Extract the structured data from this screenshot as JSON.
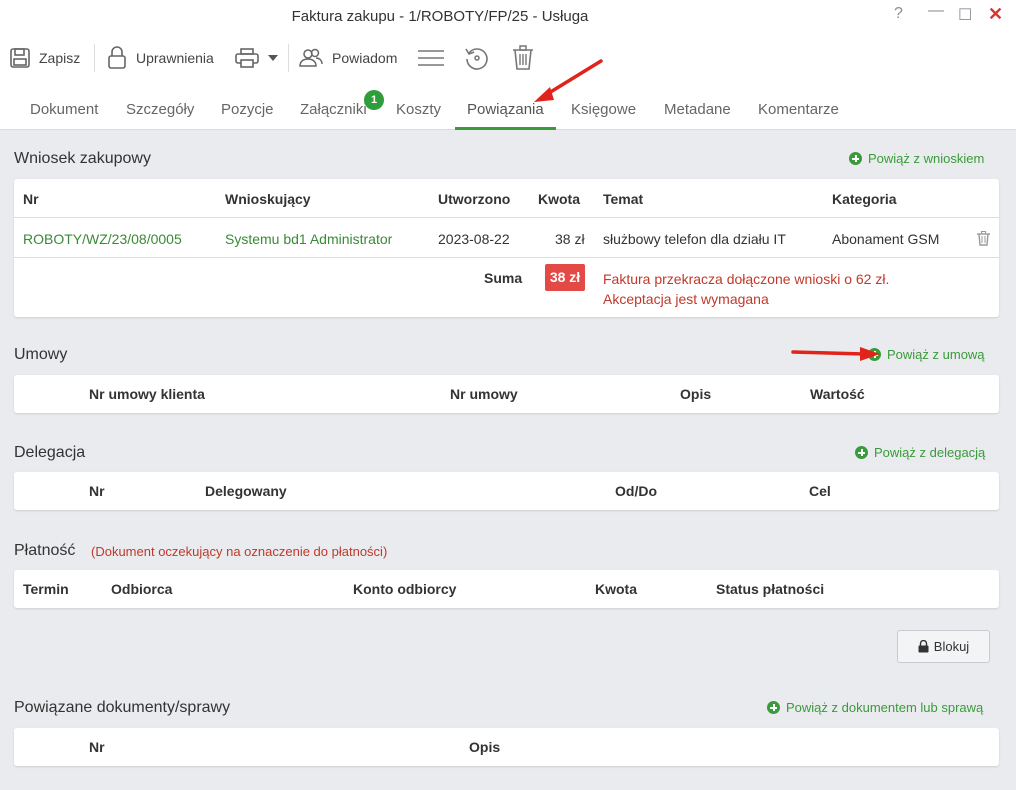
{
  "window": {
    "title": "Faktura zakupu - 1/ROBOTY/FP/25 - Usługa",
    "help": "?",
    "minimize": "—",
    "maximize": "☐",
    "close": "✕"
  },
  "toolbar": {
    "save_label": "Zapisz",
    "permissions_label": "Uprawnienia",
    "notify_label": "Powiadom"
  },
  "tabs": [
    {
      "label": "Dokument"
    },
    {
      "label": "Szczegóły"
    },
    {
      "label": "Pozycje"
    },
    {
      "label": "Załączniki",
      "badge": "1"
    },
    {
      "label": "Koszty"
    },
    {
      "label": "Powiązania",
      "active": true
    },
    {
      "label": "Księgowe"
    },
    {
      "label": "Metadane"
    },
    {
      "label": "Komentarze"
    }
  ],
  "purchase_request": {
    "title": "Wniosek zakupowy",
    "link": "Powiąż z wnioskiem",
    "headers": [
      "Nr",
      "Wnioskujący",
      "Utworzono",
      "Kwota",
      "Temat",
      "Kategoria"
    ],
    "rows": [
      {
        "nr": "ROBOTY/WZ/23/08/0005",
        "requester": "Systemu bd1 Administrator",
        "created": "2023-08-22",
        "amount": "38 zł",
        "subject": "służbowy telefon dla działu IT",
        "category": "Abonament GSM"
      }
    ],
    "sum_label": "Suma",
    "sum_value": "38 zł",
    "warning_line1": "Faktura przekracza dołączone wnioski o 62 zł.",
    "warning_line2": "Akceptacja jest wymagana"
  },
  "contracts": {
    "title": "Umowy",
    "link": "Powiąż z umową",
    "headers": [
      "Nr umowy klienta",
      "Nr umowy",
      "Opis",
      "Wartość"
    ]
  },
  "delegation": {
    "title": "Delegacja",
    "link": "Powiąż z delegacją",
    "headers": [
      "Nr",
      "Delegowany",
      "Od/Do",
      "Cel"
    ]
  },
  "payment": {
    "title": "Płatność",
    "note": "(Dokument oczekujący na oznaczenie do płatności)",
    "headers": [
      "Termin",
      "Odbiorca",
      "Konto odbiorcy",
      "Kwota",
      "Status płatności"
    ],
    "block_label": "Blokuj"
  },
  "related": {
    "title": "Powiązane dokumenty/sprawy",
    "link": "Powiąż z dokumentem lub sprawą",
    "headers": [
      "Nr",
      "Opis"
    ]
  },
  "colors": {
    "accent": "#3a9b3a",
    "danger": "#e44a45",
    "warning_text": "#c0392b"
  }
}
